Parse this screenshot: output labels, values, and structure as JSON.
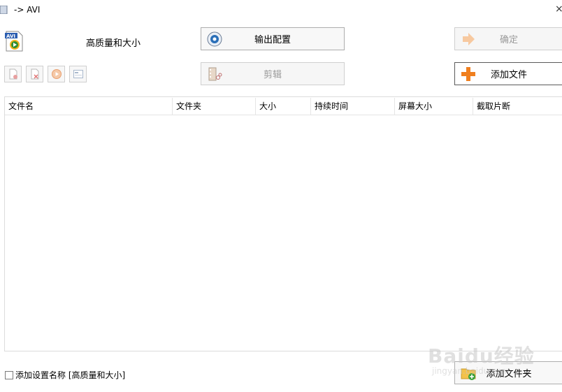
{
  "window": {
    "title": "-> AVI",
    "close_glyph": "×"
  },
  "profile": {
    "name": "高质量和大小",
    "icon": "avi-file-icon"
  },
  "buttons": {
    "output_config": "输出配置",
    "ok": "确定",
    "clip": "剪辑",
    "add_file": "添加文件",
    "add_folder": "添加文件夹"
  },
  "toolbar_icons": [
    "remove-file-icon",
    "clear-list-icon",
    "play-icon",
    "media-info-icon"
  ],
  "table": {
    "columns": [
      "文件名",
      "文件夹",
      "大小",
      "持续时间",
      "屏幕大小",
      "截取片断"
    ],
    "rows": []
  },
  "footer": {
    "checkbox_label": "添加设置名称 [高质量和大小]",
    "checked": false
  },
  "watermark": {
    "line1": "Baidu经验",
    "line2": "jingyan.baidu.com"
  },
  "colors": {
    "accent_orange": "#f07f1e",
    "disabled_text": "#9a9a9a",
    "border": "#adadad"
  }
}
